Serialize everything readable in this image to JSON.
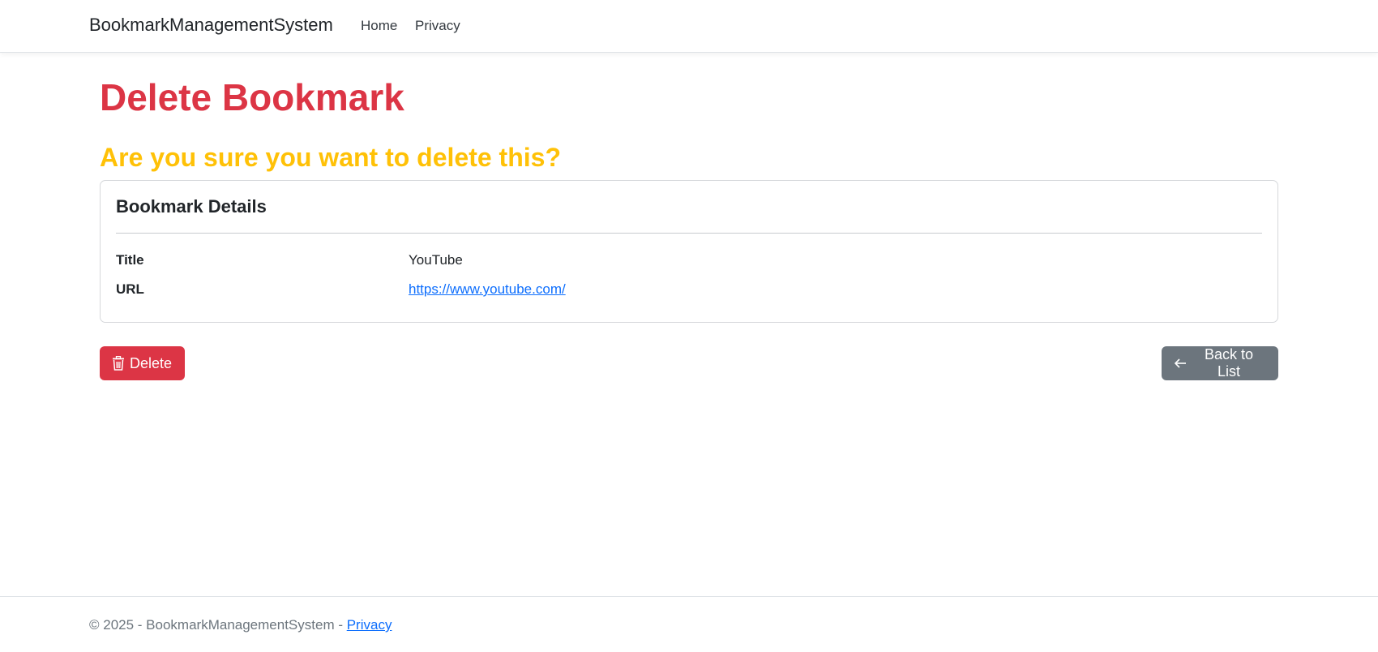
{
  "navbar": {
    "brand": "BookmarkManagementSystem",
    "links": [
      "Home",
      "Privacy"
    ]
  },
  "page": {
    "title": "Delete Bookmark",
    "confirm_text": "Are you sure you want to delete this?"
  },
  "details": {
    "heading": "Bookmark Details",
    "fields": [
      {
        "label": "Title",
        "value": "YouTube"
      },
      {
        "label": "URL",
        "value": "https://www.youtube.com/"
      }
    ]
  },
  "actions": {
    "delete_label": "Delete",
    "back_label": "Back to List"
  },
  "footer": {
    "text": "© 2025 - BookmarkManagementSystem - ",
    "privacy_link": "Privacy"
  },
  "colors": {
    "title": "#dc3545",
    "warning": "#ffc107",
    "danger": "#dc3545",
    "secondary": "#6c757d",
    "link": "#0d6efd"
  },
  "icons": {
    "delete": "trash-icon",
    "back": "arrow-left-icon"
  }
}
